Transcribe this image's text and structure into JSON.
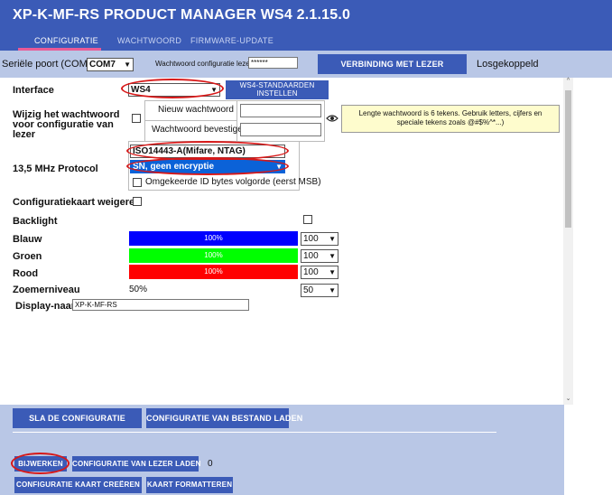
{
  "app": {
    "title": "XP-K-MF-RS  PRODUCT MANAGER WS4 2.1.15.0"
  },
  "tabs": [
    {
      "label": "CONFIGURATIE",
      "active": true
    },
    {
      "label": "WACHTWOORD",
      "active": false
    },
    {
      "label": "FIRMWARE-UPDATE",
      "active": false
    }
  ],
  "toolbar": {
    "port_label": "Seriële poort (COM)",
    "port_value": "COM7",
    "reader_password_label": "Wachtwoord configuratie lezer",
    "reader_password_value": "******",
    "connect_button": "VERBINDING MET LEZER",
    "status": "Losgekoppeld"
  },
  "form": {
    "interface_label": "Interface",
    "interface_value": "WS4",
    "ws4_defaults_button": "WS4-STANDAARDEN INSTELLEN",
    "password_label": "Wijzig het wachtwoord voor configuratie van lezer",
    "new_password_label": "Nieuw wachtwoord",
    "confirm_password_label": "Wachtwoord bevestigen",
    "password_hint": "Lengte wachtwoord is 6 tekens. Gebruik letters, cijfers en speciale tekens zoals @#$%^*...)",
    "protocol_label": "13,5 MHz Protocol",
    "protocol_value": "ISO14443-A(Mifare, NTAG)",
    "encryption_value": "SN, geen encryptie",
    "reverse_id_label": "Omgekeerde ID bytes volgorde (eerst MSB)",
    "reject_card_label": "Configuratiekaart weigeren",
    "backlight_label": "Backlight",
    "blue_label": "Blauw",
    "blue_percent": "100%",
    "blue_value": "100",
    "green_label": "Groen",
    "green_percent": "100%",
    "green_value": "100",
    "red_label": "Rood",
    "red_percent": "100%",
    "red_value": "100",
    "buzzer_label": "Zoemerniveau",
    "buzzer_percent": "50%",
    "buzzer_value": "50",
    "display_name_label": "Display-naam",
    "display_name_value": "XP-K-MF-RS"
  },
  "colors": {
    "accent": "#3b5bb7",
    "blue_bar": "#0000ff",
    "green_bar": "#00ff00",
    "red_bar": "#ff0000",
    "highlight": "#d81818"
  },
  "bottom": {
    "save_config": "SLA DE CONFIGURATIE",
    "load_file": "CONFIGURATIE VAN BESTAND LADEN",
    "update": "BIJWERKEN",
    "load_reader": "CONFIGURATIE VAN LEZER LADEN",
    "counter": "0",
    "create_card": "CONFIGURATIE KAART CREËREN",
    "format_card": "KAART FORMATTEREN"
  }
}
